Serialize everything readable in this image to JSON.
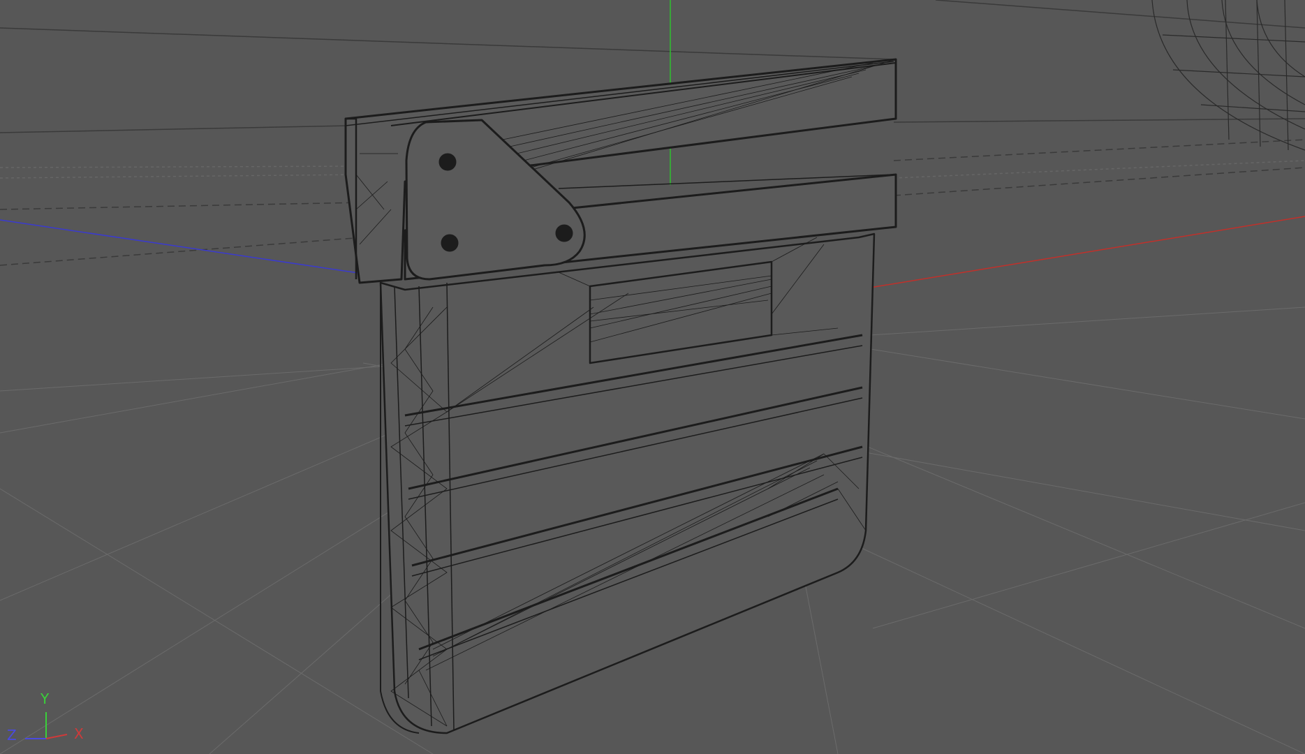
{
  "viewport": {
    "background": "#575757",
    "wire_color": "#1c1c1c",
    "grid_color": "#6a6a6a",
    "ground_line_color": "#3a3a3a"
  },
  "axes": {
    "x_color": "#c2302a",
    "y_color": "#2fbf2f",
    "z_color": "#3a3ad0"
  },
  "gizmo": {
    "x_label": "X",
    "y_label": "Y",
    "z_label": "Z",
    "x_color": "#d03a3a",
    "y_color": "#3ad03a",
    "z_color": "#4a4ae0"
  }
}
